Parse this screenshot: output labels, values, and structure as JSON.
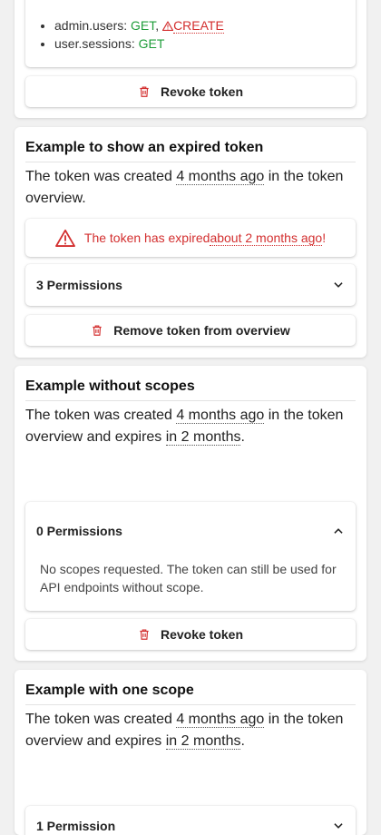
{
  "card1": {
    "scopes": [
      {
        "name": "admin.users:",
        "methods": [
          {
            "label": "GET",
            "color": "green"
          },
          {
            "label": ",",
            "color": "plain"
          },
          {
            "label": "CREATE",
            "color": "red",
            "warn": true
          }
        ]
      },
      {
        "name": "user.sessions:",
        "methods": [
          {
            "label": "GET",
            "color": "green"
          }
        ]
      }
    ],
    "revoke_label": "Revoke token"
  },
  "card2": {
    "title": "Example to show an expired token",
    "desc_prefix": "The token was created ",
    "desc_created": "4 months ago",
    "desc_suffix": " in the token overview.",
    "alert_prefix": "The token has expired ",
    "alert_time": "about 2 months ago",
    "alert_suffix": "!",
    "permissions_label": "3 Permissions",
    "remove_label": "Remove token from overview"
  },
  "card3": {
    "title": "Example without scopes",
    "desc_prefix": "The token was created ",
    "desc_created": "4 months ago",
    "desc_middle": " in the token overview and expires ",
    "desc_expires": "in 2 months",
    "desc_suffix": ".",
    "permissions_label": "0 Permissions",
    "no_scopes_text": "No scopes requested. The token can still be used for API endpoints without scope.",
    "revoke_label": "Revoke token"
  },
  "card4": {
    "title": "Example with one scope",
    "desc_prefix": "The token was created ",
    "desc_created": "4 months ago",
    "desc_middle": " in the token overview and expires ",
    "desc_expires": "in 2 months",
    "desc_suffix": ".",
    "permissions_label": "1 Permission"
  },
  "colors": {
    "green": "#1f9d3a",
    "red": "#d32f2f"
  },
  "icons": {
    "trash": "trash-icon",
    "chevron_down": "chevron-down-icon",
    "chevron_up": "chevron-up-icon",
    "warning": "warning-icon"
  }
}
